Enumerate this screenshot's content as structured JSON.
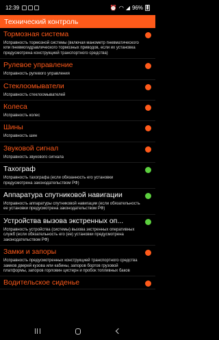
{
  "status_bar": {
    "time": "12:39",
    "battery": "96%",
    "icons": [
      "notification-icon",
      "notification-icon",
      "notification-icon",
      "alarm-icon",
      "vibrate-icon",
      "wifi-icon",
      "signal-icon",
      "battery-icon"
    ]
  },
  "header": {
    "title": "Технический контроль"
  },
  "items": [
    {
      "title": "Тормозная система",
      "desc": "Исправность тормозной системы (включая манометр пневматического или пневмогидравлического тормозных приводов, если их установка предусмотрена конструкцией транспортного средства)",
      "status": "fail",
      "status_color": "#ff5a1a"
    },
    {
      "title": "Рулевое управление",
      "desc": "Исправность рулевого управления",
      "status": "fail",
      "status_color": "#ff5a1a"
    },
    {
      "title": "Стеклоомыватели",
      "desc": "Исправность стеклоомывателей",
      "status": "fail",
      "status_color": "#ff5a1a"
    },
    {
      "title": "Колеса",
      "desc": "Исправность колес",
      "status": "fail",
      "status_color": "#ff5a1a"
    },
    {
      "title": "Шины",
      "desc": "Исправность шин",
      "status": "fail",
      "status_color": "#ff5a1a"
    },
    {
      "title": "Звуковой сигнал",
      "desc": "Исправность звукового сигнала",
      "status": "fail",
      "status_color": "#ff5a1a"
    },
    {
      "title": "Тахограф",
      "desc": "Исправность тахографа (если обязанность его установки предусмотрена законодательством РФ)",
      "status": "ok",
      "status_color": "#5ccf3e"
    },
    {
      "title": "Аппаратура спутниковой навигации",
      "desc": "Исправность аппаратуры спутниковой навигации (если обязательность ее установки предусмотрена законодательством РФ)",
      "status": "ok",
      "status_color": "#5ccf3e"
    },
    {
      "title": "Устройства вызова экстренных оп...",
      "desc": "Исправность устройства (системы) вызова экстренных оперативных служб (если обязательность его (ее) установки предусмотрена законодательством РФ)",
      "status": "ok",
      "status_color": "#5ccf3e"
    },
    {
      "title": "Замки и запоры",
      "desc": "Исправность предусмотренных конструкцией транспортного средства замков дверей кузова или кабины, запоров бортов грузовой платформы, запоров горловин цистерн и пробок топливных баков",
      "status": "fail",
      "status_color": "#ff5a1a"
    },
    {
      "title": "Водительское сиденье",
      "desc": "",
      "status": "fail",
      "status_color": "#ff5a1a"
    }
  ],
  "nav_bar": {
    "icons": [
      "recents-icon",
      "home-icon",
      "back-icon"
    ]
  },
  "colors": {
    "accent": "#ff5a1a",
    "ok": "#5ccf3e",
    "background": "#000000"
  }
}
